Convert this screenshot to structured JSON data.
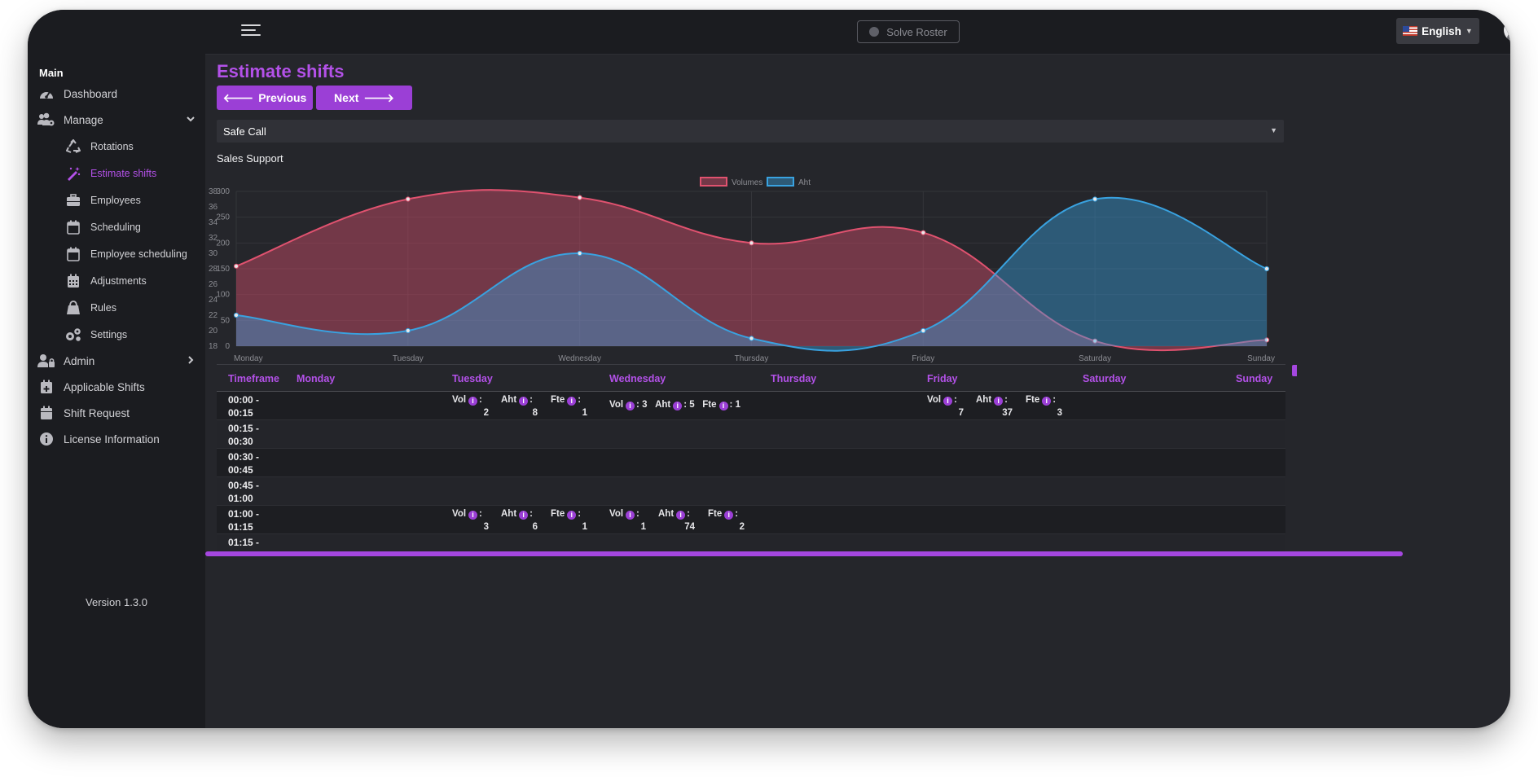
{
  "header": {
    "solve_label": "Solve Roster",
    "language": "English"
  },
  "sidebar": {
    "section_title": "Main",
    "items": [
      {
        "name": "dashboard",
        "label": "Dashboard",
        "icon": "dashboard-icon",
        "sub": false,
        "active": false,
        "chevron": ""
      },
      {
        "name": "manage",
        "label": "Manage",
        "icon": "users-cog-icon",
        "sub": false,
        "active": false,
        "chevron": "down"
      },
      {
        "name": "rotations",
        "label": "Rotations",
        "icon": "recycle-icon",
        "sub": true,
        "active": false,
        "chevron": ""
      },
      {
        "name": "estimate-shifts",
        "label": "Estimate shifts",
        "icon": "magic-wand-icon",
        "sub": true,
        "active": true,
        "chevron": ""
      },
      {
        "name": "employees",
        "label": "Employees",
        "icon": "briefcase-icon",
        "sub": true,
        "active": false,
        "chevron": ""
      },
      {
        "name": "scheduling",
        "label": "Scheduling",
        "icon": "calendar-icon",
        "sub": true,
        "active": false,
        "chevron": ""
      },
      {
        "name": "employee-scheduling",
        "label": "Employee scheduling",
        "icon": "calendar-icon",
        "sub": true,
        "active": false,
        "chevron": ""
      },
      {
        "name": "adjustments",
        "label": "Adjustments",
        "icon": "calendar-grid-icon",
        "sub": true,
        "active": false,
        "chevron": ""
      },
      {
        "name": "rules",
        "label": "Rules",
        "icon": "bag-icon",
        "sub": true,
        "active": false,
        "chevron": ""
      },
      {
        "name": "settings",
        "label": "Settings",
        "icon": "gears-icon",
        "sub": true,
        "active": false,
        "chevron": ""
      },
      {
        "name": "admin",
        "label": "Admin",
        "icon": "user-lock-icon",
        "sub": false,
        "active": false,
        "chevron": "right"
      },
      {
        "name": "applicable-shifts",
        "label": "Applicable Shifts",
        "icon": "calendar-plus-icon",
        "sub": false,
        "active": false,
        "chevron": ""
      },
      {
        "name": "shift-request",
        "label": "Shift Request",
        "icon": "calendar-solid-icon",
        "sub": false,
        "active": false,
        "chevron": ""
      },
      {
        "name": "license-information",
        "label": "License Information",
        "icon": "info-circle-icon",
        "sub": false,
        "active": false,
        "chevron": ""
      }
    ],
    "version": "Version 1.3.0"
  },
  "main": {
    "title": "Estimate shifts",
    "prev_label": "Previous",
    "next_label": "Next",
    "select_value": "Safe Call",
    "chart_title": "Sales Support"
  },
  "chart_data": {
    "type": "line",
    "title": "",
    "categories": [
      "Monday",
      "Tuesday",
      "Wednesday",
      "Thursday",
      "Friday",
      "Saturday",
      "Sunday"
    ],
    "legend_position": "top",
    "fill": true,
    "series": [
      {
        "name": "Volumes",
        "axis": "left",
        "color": "#e0526f",
        "values": [
          155,
          285,
          288,
          200,
          220,
          10,
          12
        ]
      },
      {
        "name": "Aht",
        "axis": "right",
        "color": "#39a2e0",
        "values": [
          22,
          20,
          30,
          19,
          20,
          37,
          28
        ]
      }
    ],
    "y_left": {
      "min": 0,
      "max": 300,
      "ticks": [
        0,
        50,
        100,
        150,
        200,
        250,
        300
      ]
    },
    "y_right": {
      "min": 18,
      "max": 38,
      "ticks": [
        18,
        20,
        22,
        24,
        26,
        28,
        30,
        32,
        34,
        36,
        38
      ]
    },
    "grid": true
  },
  "table": {
    "headers": [
      "Timeframe",
      "Monday",
      "Tuesday",
      "Wednesday",
      "Thursday",
      "Friday",
      "Saturday",
      "Sunday"
    ],
    "labels": {
      "vol": "Vol",
      "aht": "Aht",
      "fte": "Fte"
    },
    "rows": [
      {
        "time": "00:00 - 00:15",
        "tuesday": {
          "vol": "2",
          "aht": "8",
          "fte": "1"
        },
        "wednesday_inline": {
          "vol": "3",
          "aht": "5",
          "fte": "1"
        },
        "friday": {
          "vol": "7",
          "aht": "37",
          "fte": "3"
        }
      },
      {
        "time": "00:15 - 00:30"
      },
      {
        "time": "00:30 - 00:45"
      },
      {
        "time": "00:45 - 01:00"
      },
      {
        "time": "01:00 - 01:15",
        "tuesday": {
          "vol": "3",
          "aht": "6",
          "fte": "1"
        },
        "wednesday": {
          "vol": "1",
          "aht": "74",
          "fte": "2"
        }
      },
      {
        "time": "01:15 -"
      }
    ]
  }
}
